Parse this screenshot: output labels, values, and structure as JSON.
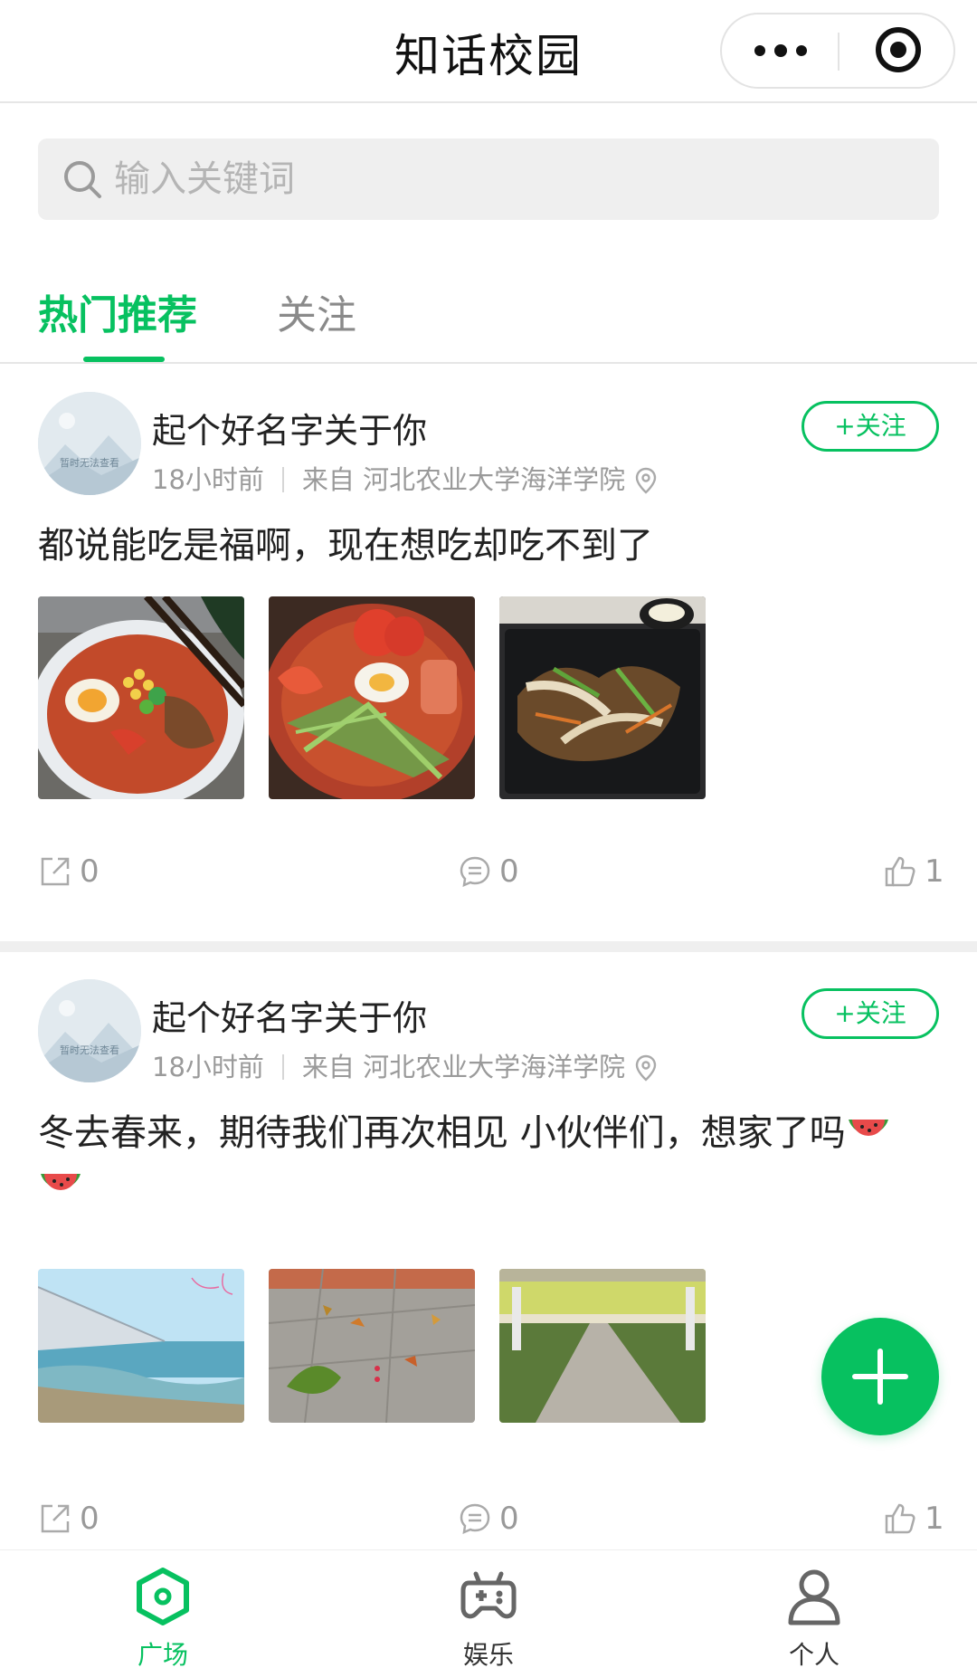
{
  "navbar": {
    "title": "知话校园"
  },
  "search": {
    "placeholder": "输入关键词"
  },
  "tabs": [
    {
      "label": "热门推荐",
      "active": true
    },
    {
      "label": "关注",
      "active": false
    }
  ],
  "posts": [
    {
      "avatar_text": "暂时无法查看",
      "username": "起个好名字关于你",
      "time": "18小时前",
      "source": "来自 河北农业大学海洋学院",
      "follow_label": "+关注",
      "text": "都说能吃是福啊，现在想吃却吃不到了",
      "images": [
        "ramen-photo",
        "cold-noodles-photo",
        "stir-fried-noodles-photo"
      ],
      "shares": "0",
      "comments": "0",
      "likes": "1"
    },
    {
      "avatar_text": "暂时无法查看",
      "username": "起个好名字关于你",
      "time": "18小时前",
      "source": "来自 河北农业大学海洋学院",
      "follow_label": "+关注",
      "text": "冬去春来，期待我们再次相见 小伙伴们，想家了吗",
      "emoji": "watermelon",
      "images": [
        "seaside-photo",
        "fallen-leaves-photo",
        "campus-path-photo"
      ],
      "shares": "0",
      "comments": "0",
      "likes": "1"
    }
  ],
  "tabbar": [
    {
      "label": "广场",
      "icon": "hexagon-icon",
      "active": true
    },
    {
      "label": "娱乐",
      "icon": "gamepad-icon",
      "active": false
    },
    {
      "label": "个人",
      "icon": "person-icon",
      "active": false
    }
  ],
  "colors": {
    "accent": "#07c160",
    "muted": "#999999",
    "separator": "#efefef"
  }
}
